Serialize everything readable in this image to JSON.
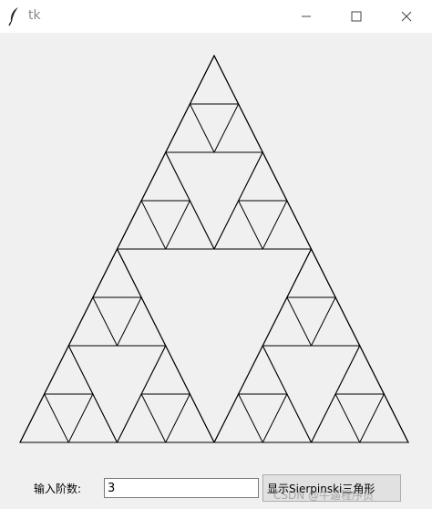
{
  "window": {
    "title": "tk",
    "icon": "feather-icon",
    "controls": [
      "minimize-icon",
      "maximize-icon",
      "close-icon"
    ]
  },
  "canvas": {
    "figure": "sierpinski-triangle",
    "order": 3,
    "line_color": "#000000",
    "background": "#f0f0f0"
  },
  "controls": {
    "order_label": "输入阶数:",
    "order_value": "3",
    "show_button_label": "显示Sierpinski三角形"
  },
  "watermark": "CSDN @牛逼程序员"
}
